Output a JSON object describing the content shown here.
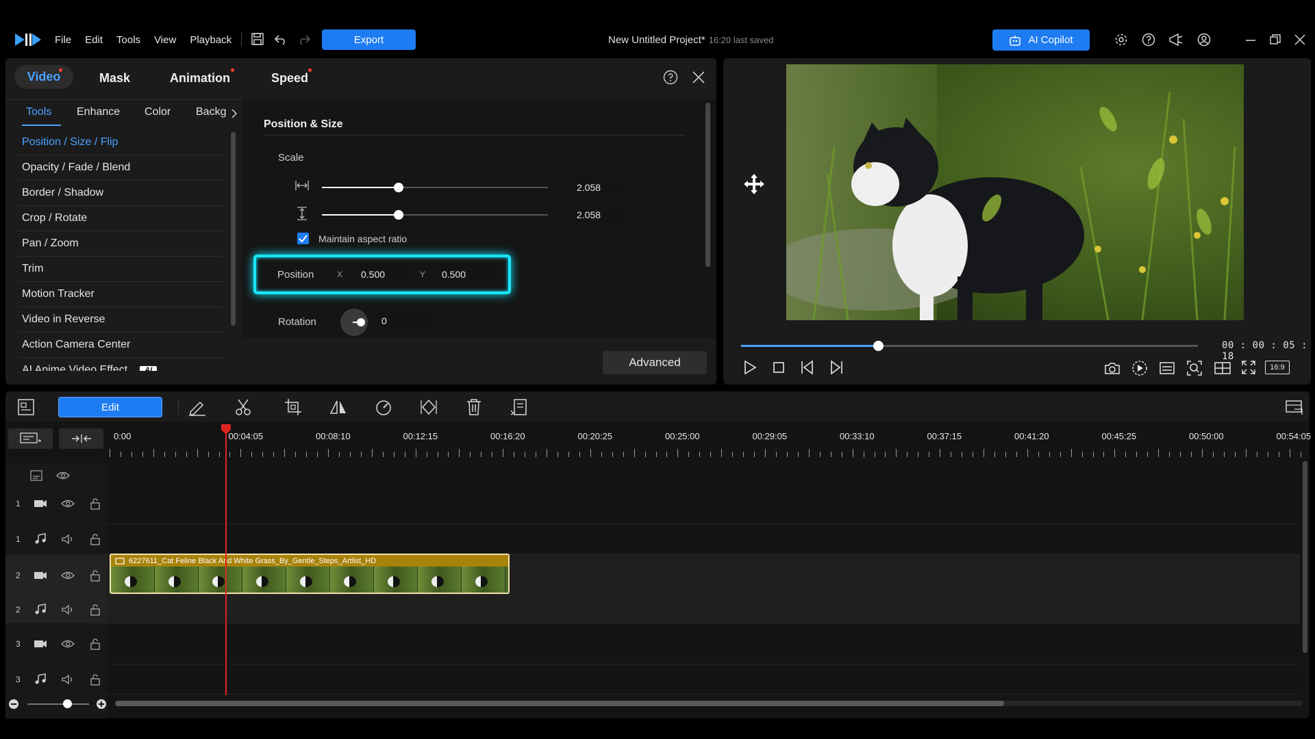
{
  "menu": [
    "File",
    "Edit",
    "Tools",
    "View",
    "Playback"
  ],
  "export_label": "Export",
  "project_title": "New Untitled Project*",
  "project_saved": "16:20 last saved",
  "copilot_label": "AI Copilot",
  "panel": {
    "tabs": [
      {
        "label": "Video",
        "dot": true
      },
      {
        "label": "Mask",
        "dot": false
      },
      {
        "label": "Animation",
        "dot": true
      },
      {
        "label": "Speed",
        "dot": true
      }
    ],
    "subtabs": [
      "Tools",
      "Enhance",
      "Color",
      "Backg"
    ],
    "tools": [
      "Position / Size / Flip",
      "Opacity / Fade / Blend",
      "Border / Shadow",
      "Crop / Rotate",
      "Pan / Zoom",
      "Trim",
      "Motion Tracker",
      "Video in Reverse",
      "Action Camera Center",
      "AI Anime Video Effect"
    ],
    "ai_badge": "AI",
    "section_title": "Position & Size",
    "scale_label": "Scale",
    "scale_width": "2.058",
    "scale_height": "2.058",
    "scale_level": 0.34,
    "maintain_aspect": "Maintain aspect ratio",
    "position_label": "Position",
    "x_label": "X",
    "x_value": "0.500",
    "y_label": "Y",
    "y_value": "0.500",
    "rotation_label": "Rotation",
    "rotation_value": "0",
    "advanced_label": "Advanced"
  },
  "preview": {
    "timecode": "00 : 00 : 05 : 18",
    "aspect": "16:9",
    "progress": 0.3
  },
  "timeline": {
    "edit_label": "Edit",
    "ruler": [
      "0:00",
      "00:04:05",
      "00:08:10",
      "00:12:15",
      "00:16:20",
      "00:20:25",
      "00:25:00",
      "00:29:05",
      "00:33:10",
      "00:37:15",
      "00:41:20",
      "00:45:25",
      "00:50:00",
      "00:54:05"
    ],
    "tracks": [
      {
        "num": "1",
        "kind": "video"
      },
      {
        "num": "1",
        "kind": "audio"
      },
      {
        "num": "2",
        "kind": "video"
      },
      {
        "num": "2",
        "kind": "audio"
      },
      {
        "num": "3",
        "kind": "video"
      },
      {
        "num": "3",
        "kind": "audio"
      }
    ],
    "clip_name": "6227611_Cat Feline Black And White Grass_By_Gentle_Steps_Artlist_HD"
  },
  "colors": {
    "accent": "#1e7cf2",
    "accent_text": "#4aa3ff",
    "highlight": "#17e6ff",
    "clip_header": "#a8820a",
    "playhead": "#e02424"
  }
}
